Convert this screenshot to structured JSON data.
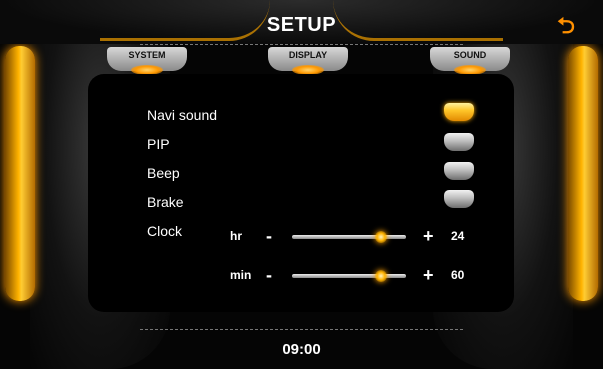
{
  "header": {
    "title": "SETUP",
    "back_icon": "back-arrow-icon"
  },
  "tabs": [
    {
      "label": "SYSTEM",
      "active": true
    },
    {
      "label": "DISPLAY",
      "active": false
    },
    {
      "label": "SOUND",
      "active": false
    }
  ],
  "settings": [
    {
      "label": "Navi sound",
      "state": "on"
    },
    {
      "label": "PIP",
      "state": "off"
    },
    {
      "label": "Beep",
      "state": "off"
    },
    {
      "label": "Brake",
      "state": "off"
    }
  ],
  "clock_setting": {
    "label": "Clock",
    "hr": {
      "unit": "hr",
      "minus": "-",
      "plus": "+",
      "value": "24",
      "slider_level_percent": 78
    },
    "min": {
      "unit": "min",
      "minus": "-",
      "plus": "+",
      "value": "60",
      "slider_level_percent": 78
    }
  },
  "footer": {
    "time": "09:00"
  },
  "colors": {
    "accent": "#ffa000",
    "background": "#000000",
    "text": "#ffffff"
  }
}
